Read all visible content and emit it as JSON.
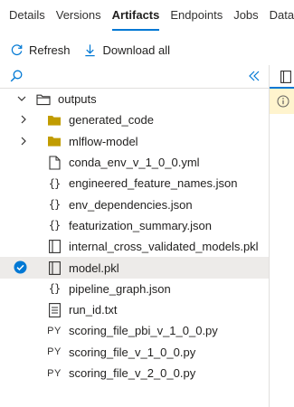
{
  "tabs": [
    "Details",
    "Versions",
    "Artifacts",
    "Endpoints",
    "Jobs",
    "Data"
  ],
  "active_tab": "Artifacts",
  "toolbar": {
    "refresh_label": "Refresh",
    "download_label": "Download all"
  },
  "tree": {
    "root": {
      "label": "outputs",
      "icon": "folder-outline-icon"
    },
    "folders": [
      {
        "label": "generated_code",
        "icon": "folder-icon"
      },
      {
        "label": "mlflow-model",
        "icon": "folder-icon"
      }
    ],
    "files": [
      {
        "label": "conda_env_v_1_0_0.yml",
        "icon": "file-icon"
      },
      {
        "label": "engineered_feature_names.json",
        "icon": "json-icon",
        "glyph": "{}"
      },
      {
        "label": "env_dependencies.json",
        "icon": "json-icon",
        "glyph": "{}"
      },
      {
        "label": "featurization_summary.json",
        "icon": "json-icon",
        "glyph": "{}"
      },
      {
        "label": "internal_cross_validated_models.pkl",
        "icon": "pkl-icon"
      },
      {
        "label": "model.pkl",
        "icon": "pkl-icon",
        "selected": true
      },
      {
        "label": "pipeline_graph.json",
        "icon": "json-icon",
        "glyph": "{}"
      },
      {
        "label": "run_id.txt",
        "icon": "text-file-icon"
      },
      {
        "label": "scoring_file_pbi_v_1_0_0.py",
        "icon": "python-icon",
        "glyph": "PY"
      },
      {
        "label": "scoring_file_v_1_0_0.py",
        "icon": "python-icon",
        "glyph": "PY"
      },
      {
        "label": "scoring_file_v_2_0_0.py",
        "icon": "python-icon",
        "glyph": "PY"
      }
    ]
  },
  "colors": {
    "accent": "#0078d4",
    "folder": "#c19c00",
    "selected_bg": "#edebe9",
    "warning_bg": "#fff4ce"
  }
}
